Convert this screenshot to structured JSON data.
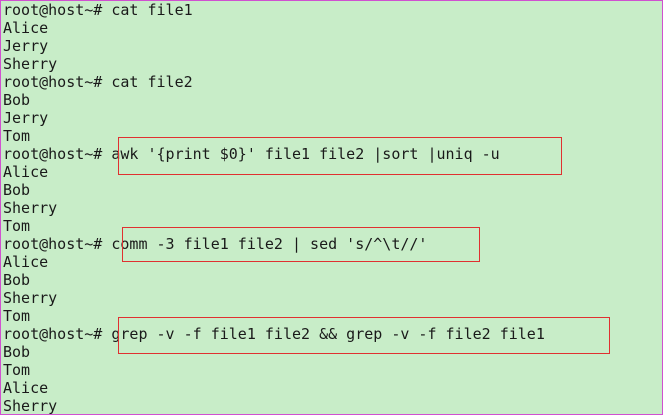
{
  "terminal": {
    "lines": [
      {
        "prompt": "root@host~# ",
        "command": "cat file1"
      },
      {
        "output": "Alice"
      },
      {
        "output": "Jerry"
      },
      {
        "output": "Sherry"
      },
      {
        "prompt": "root@host~# ",
        "command": "cat file2"
      },
      {
        "output": "Bob"
      },
      {
        "output": "Jerry"
      },
      {
        "output": "Tom"
      },
      {
        "prompt": "root@host~# ",
        "command": "awk '{print $0}' file1 file2 |sort |uniq -u"
      },
      {
        "output": "Alice"
      },
      {
        "output": "Bob"
      },
      {
        "output": "Sherry"
      },
      {
        "output": "Tom"
      },
      {
        "prompt": "root@host~# ",
        "command": "comm -3 file1 file2 | sed 's/^\\t//'"
      },
      {
        "output": "Alice"
      },
      {
        "output": "Bob"
      },
      {
        "output": "Sherry"
      },
      {
        "output": "Tom"
      },
      {
        "prompt": "root@host~# ",
        "command": "grep -v -f file1 file2 && grep -v -f file2 file1"
      },
      {
        "output": "Bob"
      },
      {
        "output": "Tom"
      },
      {
        "output": "Alice"
      },
      {
        "output": "Sherry"
      }
    ]
  },
  "colors": {
    "background": "#c8edc8",
    "text": "#1a1a1a",
    "highlight_border": "#e03030",
    "frame_border": "#d050d0"
  }
}
